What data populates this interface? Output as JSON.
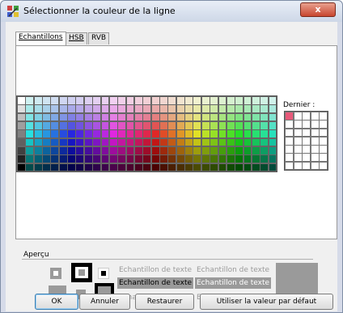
{
  "window": {
    "title": "Sélectionner la couleur de la ligne",
    "close_glyph": "x"
  },
  "tabs": [
    {
      "label": "Echantillons",
      "active": true
    },
    {
      "label": "HSB",
      "active": false
    },
    {
      "label": "RVB",
      "active": false
    }
  ],
  "recent": {
    "label": "Dernier :",
    "first_color": "#e8597a"
  },
  "preview": {
    "label": "Aperçu",
    "sample_text": "Echantillon de texte",
    "sample_color_dim": "#9a9a9a",
    "sample_color_dark": "#000000",
    "highlight_bg": "#9a9a9a",
    "big_swatch_color": "#9a9a9a"
  },
  "buttons": {
    "ok": "OK",
    "cancel": "Annuler",
    "restore": "Restaurer",
    "use_default": "Utiliser la valeur par défaut"
  }
}
